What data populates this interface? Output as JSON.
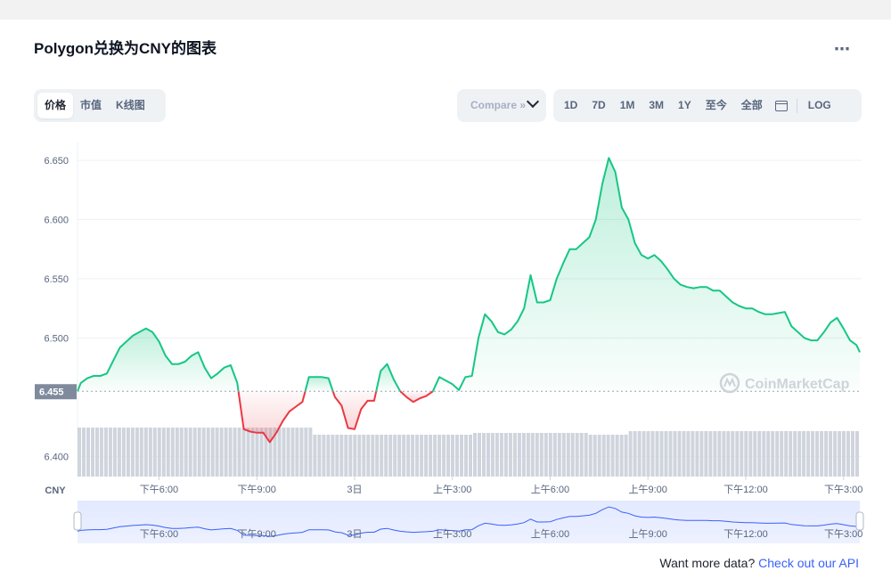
{
  "title": "Polygon兑换为CNY的图表",
  "view_tabs": [
    "价格",
    "市值",
    "K线图"
  ],
  "view_active": 0,
  "compare_label": "Compare »",
  "range_tabs": [
    "1D",
    "7D",
    "1M",
    "3M",
    "1Y",
    "至今",
    "全部"
  ],
  "range_active": 0,
  "log_label": "LOG",
  "currency_label": "CNY",
  "watermark": "CoinMarketCap",
  "footer_text": "Want more data?",
  "footer_link": "Check out our API",
  "colors": {
    "up": "#16c784",
    "down": "#ea3943",
    "brand": "#3861fb"
  },
  "chart_data": {
    "type": "line",
    "ylim": [
      6.383,
      6.665
    ],
    "ytick_labels": [
      "6.400",
      "6.500",
      "6.550",
      "6.600",
      "6.650"
    ],
    "ytick_values": [
      6.4,
      6.5,
      6.55,
      6.6,
      6.65
    ],
    "reference_price": 6.455,
    "reference_label": "6.455",
    "x_tick_labels": [
      "下午6:00",
      "下午9:00",
      "3日",
      "上午3:00",
      "上午6:00",
      "上午9:00",
      "下午12:00",
      "下午3:00"
    ],
    "x_tick_hours": [
      2.5,
      5.5,
      8.5,
      11.5,
      14.5,
      17.5,
      20.5,
      23.5
    ],
    "x_hours": [
      0,
      0.1,
      0.3,
      0.5,
      0.7,
      0.9,
      1.1,
      1.3,
      1.5,
      1.7,
      1.9,
      2.1,
      2.3,
      2.5,
      2.7,
      2.9,
      3.1,
      3.3,
      3.5,
      3.7,
      3.9,
      4.1,
      4.3,
      4.5,
      4.7,
      4.9,
      5.1,
      5.3,
      5.5,
      5.7,
      5.9,
      6.1,
      6.3,
      6.5,
      6.7,
      6.9,
      7.1,
      7.3,
      7.5,
      7.7,
      7.9,
      8.1,
      8.3,
      8.5,
      8.7,
      8.9,
      9.1,
      9.3,
      9.5,
      9.7,
      9.9,
      10.1,
      10.3,
      10.5,
      10.7,
      10.9,
      11.1,
      11.3,
      11.5,
      11.7,
      11.9,
      12.1,
      12.3,
      12.5,
      12.7,
      12.9,
      13.1,
      13.3,
      13.5,
      13.7,
      13.9,
      14.1,
      14.3,
      14.5,
      14.7,
      14.9,
      15.1,
      15.3,
      15.5,
      15.7,
      15.9,
      16.1,
      16.3,
      16.5,
      16.7,
      16.9,
      17.1,
      17.3,
      17.5,
      17.7,
      17.9,
      18.1,
      18.3,
      18.5,
      18.7,
      18.9,
      19.1,
      19.3,
      19.5,
      19.7,
      19.9,
      20.1,
      20.3,
      20.5,
      20.7,
      20.9,
      21.1,
      21.3,
      21.5,
      21.7,
      21.9,
      22.1,
      22.3,
      22.5,
      22.7,
      22.9,
      23.1,
      23.3,
      23.5,
      23.7,
      23.9,
      24
    ],
    "prices": [
      6.455,
      6.462,
      6.466,
      6.468,
      6.468,
      6.47,
      6.481,
      6.492,
      6.497,
      6.502,
      6.505,
      6.508,
      6.505,
      6.497,
      6.485,
      6.478,
      6.478,
      6.48,
      6.485,
      6.488,
      6.475,
      6.466,
      6.47,
      6.475,
      6.477,
      6.462,
      6.423,
      6.421,
      6.42,
      6.42,
      6.412,
      6.42,
      6.43,
      6.438,
      6.442,
      6.446,
      6.467,
      6.467,
      6.467,
      6.466,
      6.45,
      6.443,
      6.424,
      6.423,
      6.44,
      6.447,
      6.447,
      6.472,
      6.478,
      6.465,
      6.455,
      6.45,
      6.446,
      6.449,
      6.451,
      6.455,
      6.467,
      6.464,
      6.461,
      6.456,
      6.467,
      6.468,
      6.5,
      6.52,
      6.514,
      6.505,
      6.503,
      6.507,
      6.514,
      6.525,
      6.553,
      6.53,
      6.53,
      6.532,
      6.55,
      6.563,
      6.575,
      6.575,
      6.58,
      6.585,
      6.6,
      6.63,
      6.652,
      6.64,
      6.61,
      6.6,
      6.58,
      6.57,
      6.567,
      6.57,
      6.565,
      6.558,
      6.55,
      6.545,
      6.543,
      6.542,
      6.543,
      6.543,
      6.54,
      6.54,
      6.535,
      6.53,
      6.527,
      6.525,
      6.525,
      6.522,
      6.52,
      6.52,
      6.521,
      6.522,
      6.51,
      6.505,
      6.5,
      6.498,
      6.498,
      6.505,
      6.513,
      6.517,
      6.508,
      6.498,
      6.494,
      6.488,
      6.483
    ]
  }
}
